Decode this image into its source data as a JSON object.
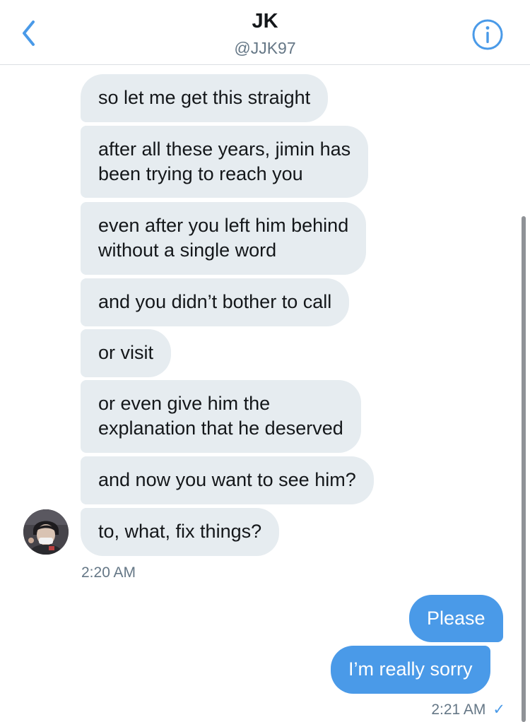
{
  "header": {
    "title": "JK",
    "handle": "@JJK97"
  },
  "messages": {
    "received": [
      "so let me get this straight",
      "after all these years, jimin has\nbeen trying to reach you",
      "even after you left him behind\nwithout a single word",
      "and you didn’t bother to call",
      "or visit",
      "or even give him the\nexplanation that he deserved",
      "and now you want to see him?",
      "to, what, fix things?"
    ],
    "received_time": "2:20 AM",
    "sent": [
      "Please",
      "I’m really sorry"
    ],
    "sent_time": "2:21 AM",
    "sent_status": "✓"
  },
  "colors": {
    "sent_bubble": "#4a9ae8",
    "received_bubble": "#e6ecf0",
    "accent": "#4a9ae8"
  }
}
